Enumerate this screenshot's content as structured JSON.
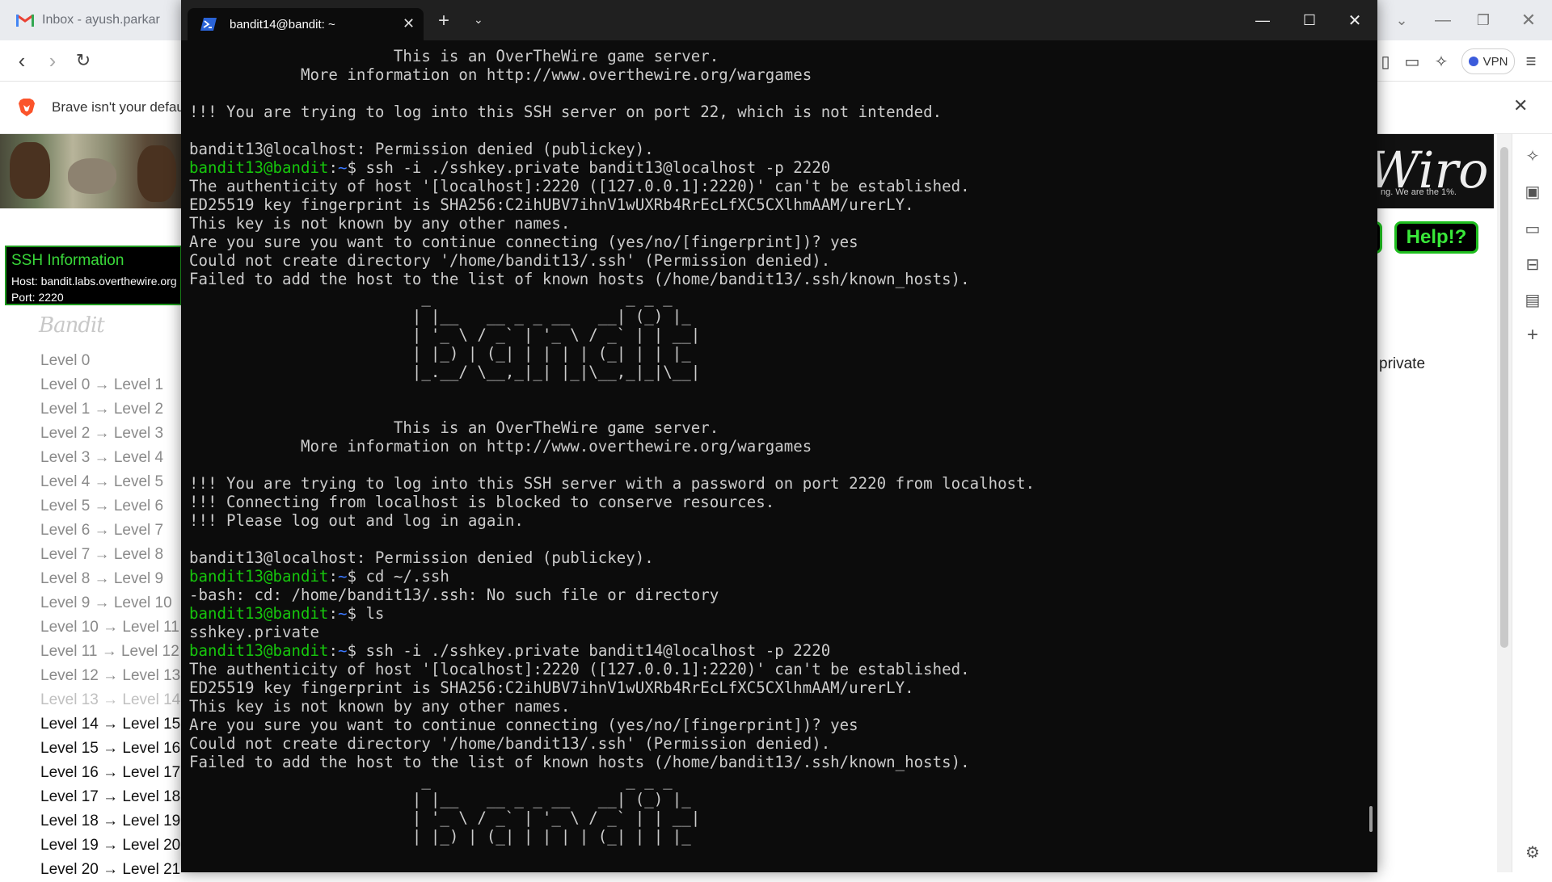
{
  "browser": {
    "tab_title": "Inbox - ayush.parkar",
    "infobar_text": "Brave isn't your defaul",
    "vpn_label": "VPN",
    "ssh_info": {
      "title": "SSH Information",
      "host": "Host: bandit.labs.overthewire.org",
      "port": "Port: 2220"
    },
    "logo_text": "Bandit",
    "wiro_text": "Wiro",
    "wiro_sub": "ng. We are the 1%.",
    "help_label": "Help!?",
    "private_text": "private",
    "levels": [
      "Level 0",
      "Level 0 → Level 1",
      "Level 1 → Level 2",
      "Level 2 → Level 3",
      "Level 3 → Level 4",
      "Level 4 → Level 5",
      "Level 5 → Level 6",
      "Level 6 → Level 7",
      "Level 7 → Level 8",
      "Level 8 → Level 9",
      "Level 9 → Level 10",
      "Level 10 → Level 11",
      "Level 11 → Level 12",
      "Level 12 → Level 13",
      "Level 13 → Level 14",
      "Level 14 → Level 15",
      "Level 15 → Level 16",
      "Level 16 → Level 17",
      "Level 17 → Level 18",
      "Level 18 → Level 19",
      "Level 19 → Level 20",
      "Level 20 → Level 21"
    ],
    "visited_count": 14,
    "current_index": 14,
    "colors": {
      "visited": "#8a8a8a",
      "current": "#c0c0c0",
      "unvisited": "#111111"
    }
  },
  "terminal": {
    "tab_title": "bandit14@bandit: ~",
    "user_host": "bandit13@bandit",
    "path": "~",
    "colors": {
      "background": "#0c0c0c",
      "text": "#cccccc",
      "user": "#16c60c",
      "path": "#3b78ff"
    },
    "lines": [
      {
        "type": "text",
        "text": "                      This is an OverTheWire game server."
      },
      {
        "type": "text",
        "text": "            More information on http://www.overthewire.org/wargames"
      },
      {
        "type": "text",
        "text": ""
      },
      {
        "type": "text",
        "text": "!!! You are trying to log into this SSH server on port 22, which is not intended."
      },
      {
        "type": "text",
        "text": ""
      },
      {
        "type": "text",
        "text": "bandit13@localhost: Permission denied (publickey)."
      },
      {
        "type": "prompt",
        "cmd": "ssh -i ./sshkey.private bandit13@localhost -p 2220"
      },
      {
        "type": "text",
        "text": "The authenticity of host '[localhost]:2220 ([127.0.0.1]:2220)' can't be established."
      },
      {
        "type": "text",
        "text": "ED25519 key fingerprint is SHA256:C2ihUBV7ihnV1wUXRb4RrEcLfXC5CXlhmAAM/urerLY."
      },
      {
        "type": "text",
        "text": "This key is not known by any other names."
      },
      {
        "type": "text",
        "text": "Are you sure you want to continue connecting (yes/no/[fingerprint])? yes"
      },
      {
        "type": "text",
        "text": "Could not create directory '/home/bandit13/.ssh' (Permission denied)."
      },
      {
        "type": "text",
        "text": "Failed to add the host to the list of known hosts (/home/bandit13/.ssh/known_hosts)."
      },
      {
        "type": "text",
        "text": "                         _                     _ _ _"
      },
      {
        "type": "text",
        "text": "                        | |__   __ _ _ __   __| (_) |_"
      },
      {
        "type": "text",
        "text": "                        | '_ \\ / _` | '_ \\ / _` | | __|"
      },
      {
        "type": "text",
        "text": "                        | |_) | (_| | | | | (_| | | |_"
      },
      {
        "type": "text",
        "text": "                        |_.__/ \\__,_|_| |_|\\__,_|_|\\__|"
      },
      {
        "type": "text",
        "text": ""
      },
      {
        "type": "text",
        "text": ""
      },
      {
        "type": "text",
        "text": "                      This is an OverTheWire game server."
      },
      {
        "type": "text",
        "text": "            More information on http://www.overthewire.org/wargames"
      },
      {
        "type": "text",
        "text": ""
      },
      {
        "type": "text",
        "text": "!!! You are trying to log into this SSH server with a password on port 2220 from localhost."
      },
      {
        "type": "text",
        "text": "!!! Connecting from localhost is blocked to conserve resources."
      },
      {
        "type": "text",
        "text": "!!! Please log out and log in again."
      },
      {
        "type": "text",
        "text": ""
      },
      {
        "type": "text",
        "text": "bandit13@localhost: Permission denied (publickey)."
      },
      {
        "type": "prompt",
        "cmd": "cd ~/.ssh"
      },
      {
        "type": "text",
        "text": "-bash: cd: /home/bandit13/.ssh: No such file or directory"
      },
      {
        "type": "prompt",
        "cmd": "ls"
      },
      {
        "type": "text",
        "text": "sshkey.private"
      },
      {
        "type": "prompt",
        "cmd": "ssh -i ./sshkey.private bandit14@localhost -p 2220"
      },
      {
        "type": "text",
        "text": "The authenticity of host '[localhost]:2220 ([127.0.0.1]:2220)' can't be established."
      },
      {
        "type": "text",
        "text": "ED25519 key fingerprint is SHA256:C2ihUBV7ihnV1wUXRb4RrEcLfXC5CXlhmAAM/urerLY."
      },
      {
        "type": "text",
        "text": "This key is not known by any other names."
      },
      {
        "type": "text",
        "text": "Are you sure you want to continue connecting (yes/no/[fingerprint])? yes"
      },
      {
        "type": "text",
        "text": "Could not create directory '/home/bandit13/.ssh' (Permission denied)."
      },
      {
        "type": "text",
        "text": "Failed to add the host to the list of known hosts (/home/bandit13/.ssh/known_hosts)."
      },
      {
        "type": "text",
        "text": "                         _                     _ _ _"
      },
      {
        "type": "text",
        "text": "                        | |__   __ _ _ __   __| (_) |_"
      },
      {
        "type": "text",
        "text": "                        | '_ \\ / _` | '_ \\ / _` | | __|"
      },
      {
        "type": "text",
        "text": "                        | |_) | (_| | | | | (_| | | |_"
      }
    ]
  }
}
